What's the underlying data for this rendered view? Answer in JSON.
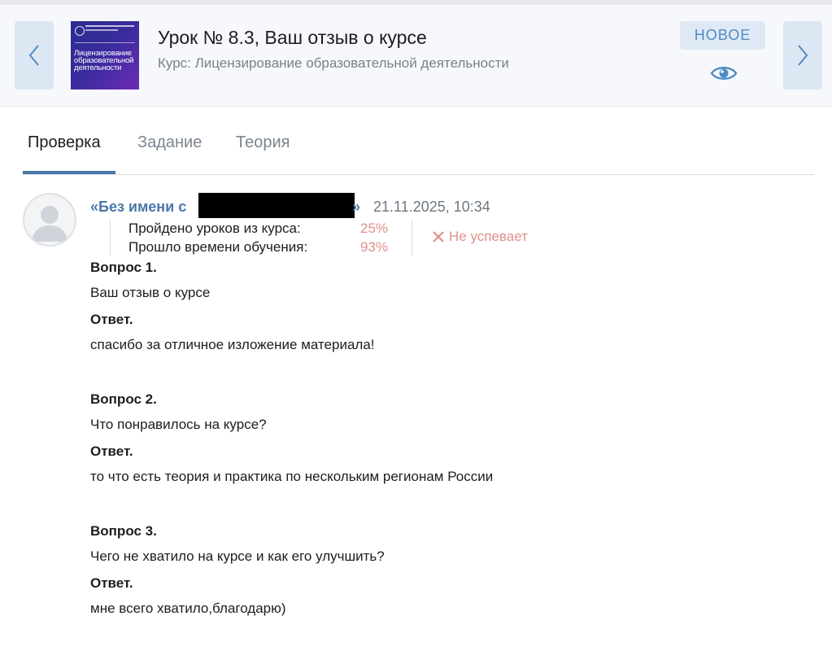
{
  "header": {
    "lesson_title": "Урок № 8.3, Ваш отзыв о курсе",
    "course_name": "Курс: Лицензирование образовательной деятельности",
    "badge": "НОВОЕ",
    "cover_title": "Лицензирование образовательной деятельности",
    "prev_icon": "chevron-left-icon",
    "next_icon": "chevron-right-icon",
    "eye_icon": "eye-icon"
  },
  "tabs": [
    {
      "label": "Проверка",
      "active": true
    },
    {
      "label": "Задание",
      "active": false
    },
    {
      "label": "Теория",
      "active": false
    }
  ],
  "submission": {
    "author_prefix": "«Без имени с",
    "author_suffix": "»",
    "timestamp": "21.11.2025, 10:34",
    "stats": [
      {
        "label": "Пройдено уроков из курса:",
        "value": "25%"
      },
      {
        "label": "Прошло времени обучения:",
        "value": "93%"
      }
    ],
    "status": "Не успевает",
    "status_icon": "cross-icon"
  },
  "qa": [
    {
      "question_label": "Вопрос 1.",
      "question": "Ваш отзыв о курсе",
      "answer_label": "Ответ.",
      "answer": "спасибо за отличное изложение материала!"
    },
    {
      "question_label": "Вопрос 2.",
      "question": "Что понравилось на курсе?",
      "answer_label": "Ответ.",
      "answer": "то что есть теория и практика по нескольким регионам России"
    },
    {
      "question_label": "Вопрос 3.",
      "question": "Чего не хватило на курсе и как его улучшить?",
      "answer_label": "Ответ.",
      "answer": "мне всего хватило,благодарю)"
    }
  ],
  "colors": {
    "accent": "#4a77a8",
    "badge_bg": "#dfe9f5",
    "warning": "#e0908a",
    "muted": "#77818c"
  }
}
